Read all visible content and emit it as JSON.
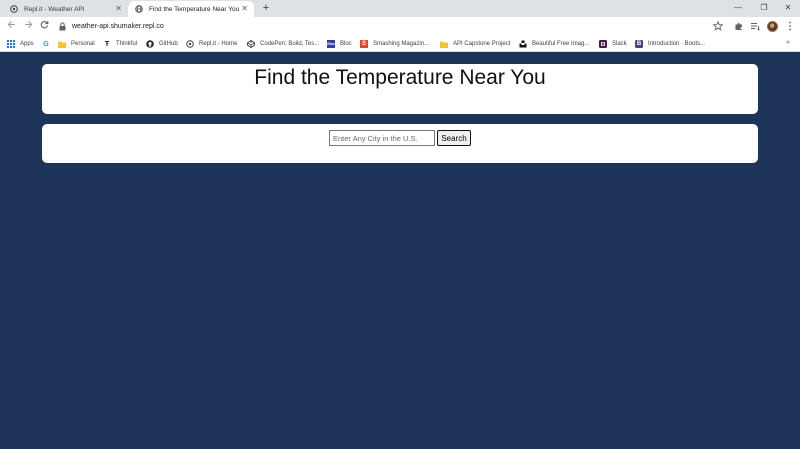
{
  "browser": {
    "tabs": [
      {
        "title": "Repl.it - Weather API",
        "active": false
      },
      {
        "title": "Find the Temperature Near You",
        "active": true
      }
    ],
    "new_tab_symbol": "+",
    "close_symbol": "✕",
    "window_controls": {
      "minimize": "—",
      "maximize": "❐",
      "close": "✕"
    },
    "address": "weather-api.shumaker.repl.co",
    "bookmarks": [
      {
        "label": "Apps",
        "icon": "apps-grid-icon"
      },
      {
        "label": "",
        "icon": "google-icon",
        "glyph": "G"
      },
      {
        "label": "Personal",
        "icon": "folder-icon"
      },
      {
        "label": "Thinkful",
        "icon": "thinkful-icon",
        "glyph": "Ŧ"
      },
      {
        "label": "GitHub",
        "icon": "github-icon"
      },
      {
        "label": "Repl.it - Home",
        "icon": "replit-icon"
      },
      {
        "label": "CodePen: Build, Tes...",
        "icon": "codepen-icon"
      },
      {
        "label": "Bloc",
        "icon": "bloc-icon",
        "glyph": "Bloc"
      },
      {
        "label": "Smashing Magazin...",
        "icon": "smashing-icon",
        "glyph": "S"
      },
      {
        "label": "API Capstone Project",
        "icon": "folder-icon"
      },
      {
        "label": "Beautiful Free Imag...",
        "icon": "unsplash-icon"
      },
      {
        "label": "Slack",
        "icon": "slack-icon"
      },
      {
        "label": "Introduction · Boots...",
        "icon": "bootstrap-icon",
        "glyph": "B"
      }
    ],
    "more_symbol": "»",
    "colors": {
      "tab_strip": "#dee1e6",
      "toolbar": "#ffffff"
    }
  },
  "page": {
    "title": "Find the Temperature Near You",
    "search": {
      "placeholder": "Enter Any City in the U.S.",
      "value": "",
      "button_label": "Search"
    },
    "colors": {
      "background": "#1e3459",
      "card": "#ffffff"
    }
  }
}
